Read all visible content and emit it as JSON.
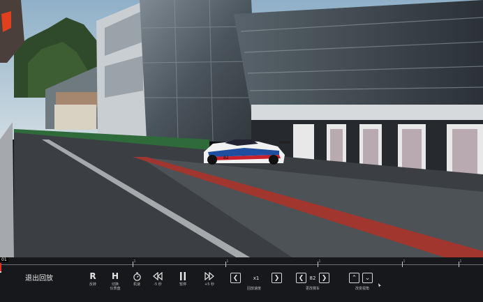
{
  "timeline": {
    "lap_label": "01",
    "progress": 0.003,
    "ticks": [
      {
        "pos": 0.275,
        "label": "1"
      },
      {
        "pos": 0.467,
        "label": "1"
      },
      {
        "pos": 0.657,
        "label": "1"
      },
      {
        "pos": 0.832,
        "label": "1"
      },
      {
        "pos": 0.95,
        "label": "1"
      }
    ]
  },
  "controls": {
    "exit_label": "退出回放",
    "rewind_key": "R",
    "rewind_caption": "反转",
    "hud_key": "H",
    "hud_caption_1": "切换",
    "hud_caption_2": "仪表盘",
    "timer_caption": "机速",
    "back5_caption": "-5 秒",
    "pause_caption": "暂停",
    "fwd5_caption": "+5 秒",
    "speed_value": "x1",
    "speed_caption": "回放速度",
    "car_value": "82",
    "car_caption": "更改赛车",
    "camera_caption": "改变视角"
  },
  "scene": {
    "car_number": "82",
    "sky_color": "#a9c2d4",
    "track_color": "#3b3f44",
    "pitlane_stripe_color": "#a0362e"
  }
}
